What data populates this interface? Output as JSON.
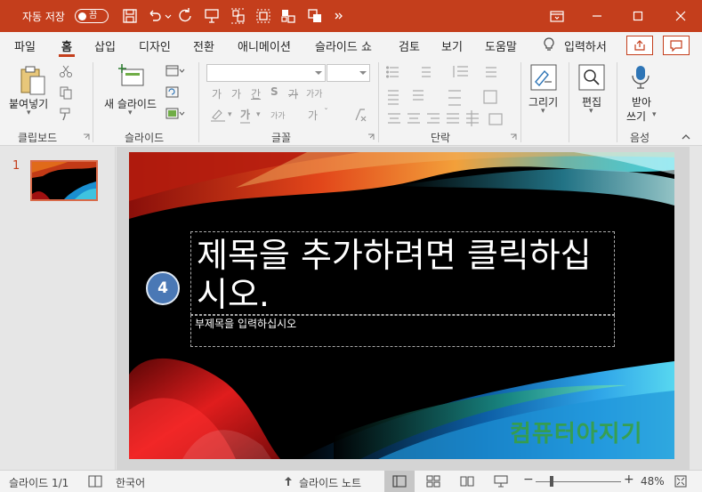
{
  "titlebar": {
    "autosave_label": "자동 저장",
    "autosave_state": "끔"
  },
  "tabs": [
    {
      "label": "파일"
    },
    {
      "label": "홈"
    },
    {
      "label": "삽입"
    },
    {
      "label": "디자인"
    },
    {
      "label": "전환"
    },
    {
      "label": "애니메이션"
    },
    {
      "label": "슬라이드 쇼"
    },
    {
      "label": "검토"
    },
    {
      "label": "보기"
    },
    {
      "label": "도움말"
    }
  ],
  "active_tab": "홈",
  "tell_me": "입력하서",
  "ribbon": {
    "paste_label": "붙여넣기",
    "new_slide_label": "새 슬라이드",
    "draw_label": "그리기",
    "edit_label": "편집",
    "dictate_label_1": "받아",
    "dictate_label_2": "쓰기",
    "font_sample_1": "가",
    "font_sample_2": "가",
    "font_sample_3": "간",
    "font_sample_4": "S",
    "font_sample_5": "가",
    "font_sample_6": "가가",
    "font_sample_7": "가",
    "font_sample_8": "가",
    "groups": {
      "clipboard": "클립보드",
      "slides": "슬라이드",
      "font": "글꼴",
      "paragraph": "단락",
      "voice": "음성"
    }
  },
  "thumbnail": {
    "number": "1"
  },
  "slide": {
    "title": "제목을 추가하려면 클릭하십시오.",
    "subtitle": "부제목을 입력하십시오",
    "step_badge": "4",
    "watermark": "컴퓨터아지기"
  },
  "status": {
    "slide_count": "슬라이드 1/1",
    "language": "한국어",
    "notes": "슬라이드 노트",
    "zoom": "48%"
  },
  "colors": {
    "accent": "#c43e1c",
    "badge": "#4a78b5"
  }
}
